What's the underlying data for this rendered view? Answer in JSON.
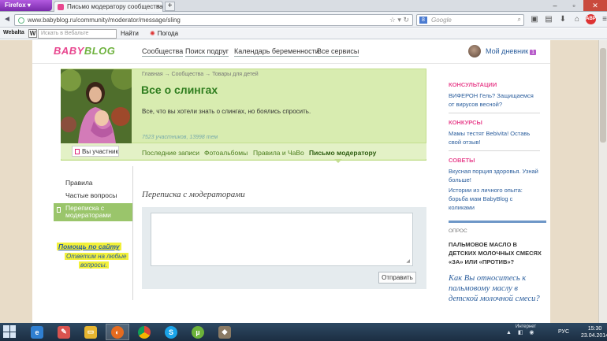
{
  "browser": {
    "menu_label": "Firefox",
    "tab_title": "Письмо модератору сообщества \"Все ...",
    "url": "www.babyblog.ru/community/moderator/message/sling",
    "search_engine": "Google",
    "search_placeholder": "Google"
  },
  "toolbar": {
    "webalta_label": "Webalta",
    "webalta_icon": "W",
    "search_placeholder": "Искать в Вебальте",
    "go_label": "Найти",
    "weather_label": "Погода"
  },
  "site": {
    "logo_part1": "BABY",
    "logo_part2": "BLOG",
    "nav": [
      "Сообщества",
      "Поиск подруг",
      "Календарь беременности",
      "Все сервисы"
    ],
    "my_diary": "Мой дневник",
    "my_diary_badge": "1"
  },
  "community": {
    "breadcrumb": "Главная → Сообщества → Товары для детей",
    "title": "Все о слингах",
    "description": "Все, что вы хотели знать о слингах, но боялись спросить.",
    "stats": "7523 участников, 13998 тем",
    "participant_label": "Вы участник",
    "tabs": [
      "Последние записи",
      "Фотоальбомы",
      "Правила и ЧаВо",
      "Письмо модератору"
    ],
    "active_tab": "Письмо модератору"
  },
  "left_menu": {
    "items": [
      "Правила",
      "Частые вопросы"
    ],
    "active_item": "Переписка с модераторами",
    "help_title": "Помощь по сайту",
    "help_line2": "Ответим на любые",
    "help_line3": "вопросы."
  },
  "form": {
    "title": "Переписка с модераторами",
    "message_value": "",
    "send_label": "Отправить"
  },
  "sidebar": {
    "consult_head": "КОНСУЛЬТАЦИИ",
    "consult_link": "ВИФЕРОН Гель? Защищаемся от вирусов весной?",
    "contest_head": "КОНКУРСЫ",
    "contest_link": "Мамы тестят Bebivita! Оставь свой отзыв!",
    "tips_head": "СОВЕТЫ",
    "tips_link1": "Вкусная порция здоровья. Узнай больше!",
    "tips_link2": "Истории из личного опыта: борьба мам BabyBlog с коликами",
    "poll_head": "ОПРОС",
    "poll_title": "ПАЛЬМОВОЕ МАСЛО В ДЕТСКИХ МОЛОЧНЫХ СМЕСЯХ «ЗА» ИЛИ «ПРОТИВ»?",
    "poll_question": "Как Вы относитесь к пальмовому маслу в детской молочной смеси?"
  },
  "taskbar": {
    "apps": [
      "ie-icon",
      "paint-icon",
      "explorer-icon",
      "firefox-icon",
      "chrome-icon",
      "skype-icon",
      "utorrent-icon",
      "gimp-icon"
    ],
    "tray_side": "Интернет",
    "lang": "РУС",
    "time": "15:30",
    "date": "23.04.2014"
  },
  "colors": {
    "brand_pink": "#e8478f",
    "brand_green": "#6fb23f",
    "band_green": "#d8ecb0",
    "link_blue": "#2a5d9c"
  }
}
